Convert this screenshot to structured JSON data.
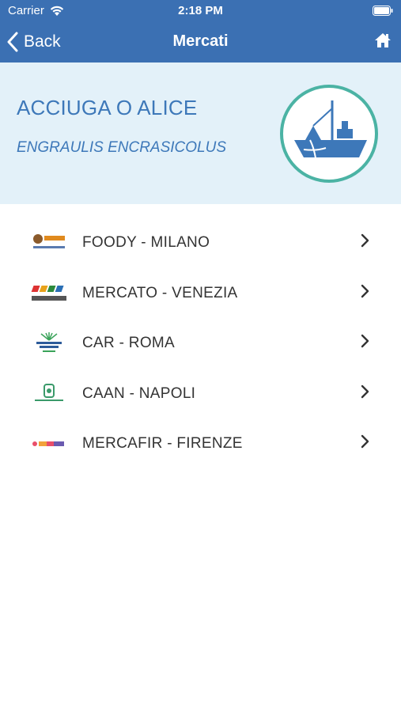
{
  "status_bar": {
    "carrier": "Carrier",
    "time": "2:18 PM"
  },
  "nav": {
    "back_label": "Back",
    "title": "Mercati",
    "home_icon": "home-icon"
  },
  "species": {
    "common_name": "ACCIUGA O ALICE",
    "latin_name": "ENGRAULIS ENCRASICOLUS",
    "icon": "fishing-boat-icon"
  },
  "colors": {
    "nav_bg": "#3b70b3",
    "hero_bg": "#e3f1f9",
    "accent": "#3d78b9",
    "badge_ring": "#4bb3a4"
  },
  "markets": [
    {
      "label": "FOODY - MILANO",
      "logo": "foody-logo"
    },
    {
      "label": "MERCATO - VENEZIA",
      "logo": "veritas-logo"
    },
    {
      "label": "CAR - ROMA",
      "logo": "car-roma-logo"
    },
    {
      "label": "CAAN - NAPOLI",
      "logo": "caan-logo"
    },
    {
      "label": "MERCAFIR - FIRENZE",
      "logo": "mercafir-logo"
    }
  ]
}
